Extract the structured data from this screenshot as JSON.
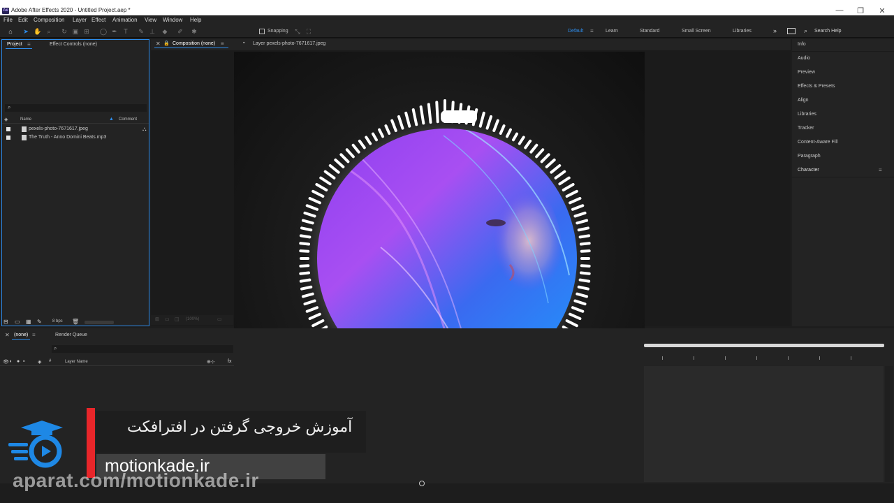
{
  "window": {
    "title": "Adobe After Effects 2020 - Untitled Project.aep *",
    "logo": "Ae",
    "controls": [
      "—",
      "❐",
      "✕"
    ]
  },
  "menu": [
    "File",
    "Edit",
    "Composition",
    "Layer",
    "Effect",
    "Animation",
    "View",
    "Window",
    "Help"
  ],
  "toolbar": {
    "snapping_label": "Snapping",
    "workspaces": [
      "Default",
      "Learn",
      "Standard",
      "Small Screen",
      "Libraries"
    ],
    "active_workspace": "Default",
    "search_placeholder": "Search Help"
  },
  "project_panel": {
    "tab_project": "Project",
    "tab_effect_controls": "Effect Controls (none)",
    "col_name": "Name",
    "col_comment": "Comment",
    "items": [
      "pexels-photo-7671617.jpeg",
      "The Truth - Anno Domini Beats.mp3"
    ],
    "bpc": "8 bpc"
  },
  "comp_panel": {
    "tab_composition": "Composition (none)",
    "tab_layer": "Layer pexels-photo-7671617.jpeg",
    "zoom": "(100%)"
  },
  "right_panel": {
    "items": [
      "Info",
      "Audio",
      "Preview",
      "Effects & Presets",
      "Align",
      "Libraries",
      "Tracker",
      "Content-Aware Fill",
      "Paragraph",
      "Character"
    ]
  },
  "timeline": {
    "tab_none": "(none)",
    "tab_render_queue": "Render Queue",
    "col_layer_name": "Layer Name"
  },
  "overlay": {
    "persian_title": "آموزش خروجی گرفتن در افترافکت",
    "site": "motionkade.ir",
    "watermark": "aparat.com/motionkade.ir"
  },
  "colors": {
    "accent": "#2d8ceb",
    "brand_red": "#e8262a",
    "brand_blue": "#1e88e5"
  }
}
